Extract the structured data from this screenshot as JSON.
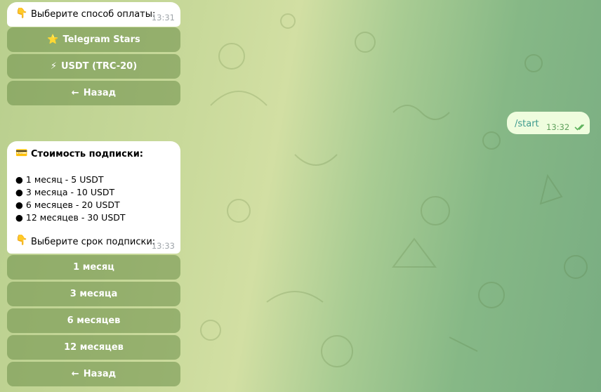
{
  "payment_prompt": {
    "icon": "pointing-down-hand-icon",
    "text": "Выберите способ оплаты:",
    "time": "13:31"
  },
  "payment_buttons": [
    {
      "icon": "star-icon",
      "glyph": "⭐",
      "label": "Telegram Stars"
    },
    {
      "icon": "lightning-icon",
      "glyph": "⚡",
      "label": "USDT (TRC-20)"
    },
    {
      "icon": "arrow-left-icon",
      "glyph": "←",
      "label": "Назад"
    }
  ],
  "outgoing": {
    "text": "/start",
    "time": "13:32",
    "status_icon": "double-check-icon"
  },
  "subscription_message": {
    "title_icon": "card-icon",
    "title": "Стоимость подписки:",
    "items": [
      "1 месяц - 5 USDT",
      "3 месяца - 10 USDT",
      "6 месяцев - 20 USDT",
      "12 месяцев - 30 USDT"
    ],
    "prompt_icon": "pointing-down-hand-icon",
    "prompt": "Выберите срок подписки:",
    "time": "13:33"
  },
  "period_buttons": [
    {
      "label": "1 месяц"
    },
    {
      "label": "3 месяца"
    },
    {
      "label": "6 месяцев"
    },
    {
      "label": "12 месяцев"
    },
    {
      "glyph": "←",
      "label": "Назад"
    }
  ],
  "colors": {
    "outgoing_bubble": "#effdde",
    "accent_link": "#3e9a8e",
    "check": "#5fb35d"
  }
}
